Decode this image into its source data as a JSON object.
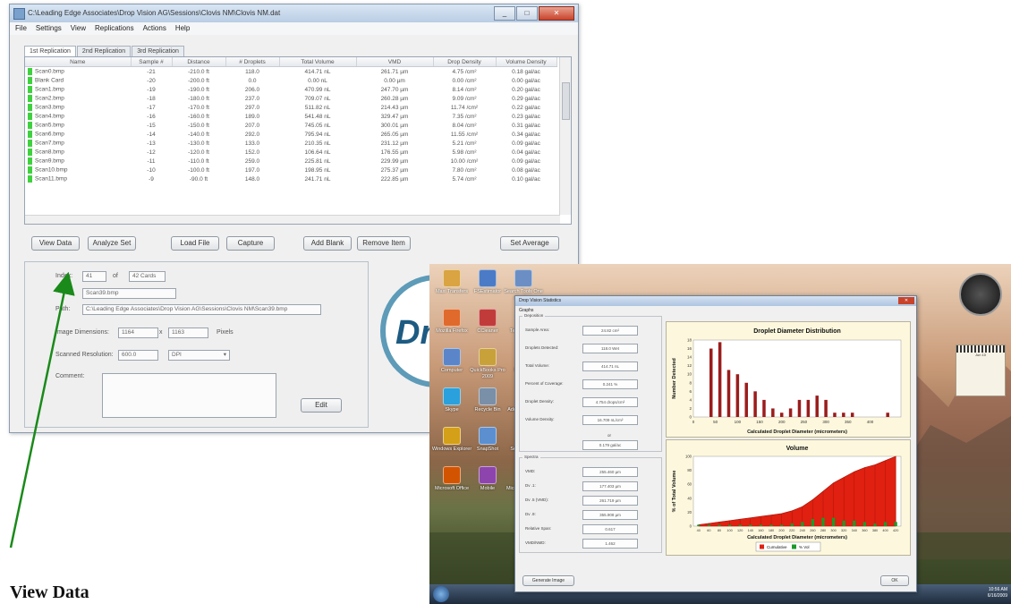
{
  "main_window": {
    "title": "C:\\Leading Edge Associates\\Drop Vision AG\\Sessions\\Clovis  NM\\Clovis  NM.dat",
    "menu": [
      "File",
      "Settings",
      "View",
      "Replications",
      "Actions",
      "Help"
    ],
    "tabs": [
      "1st Replication",
      "2nd Replication",
      "3rd Replication"
    ],
    "columns": [
      "Name",
      "Sample #",
      "Distance",
      "# Droplets",
      "Total Volume",
      "VMD",
      "Drop Density",
      "Volume Density"
    ],
    "rows": [
      [
        "Scan0.bmp",
        "-21",
        "-210.0 ft",
        "118.0",
        "414.71 nL",
        "261.71 µm",
        "4.75 /cm²",
        "0.18 gal/ac"
      ],
      [
        "Blank Card",
        "-20",
        "-200.0 ft",
        "0.0",
        "0.00 nL",
        "0.00 µm",
        "0.00 /cm²",
        "0.00 gal/ac"
      ],
      [
        "Scan1.bmp",
        "-19",
        "-190.0 ft",
        "206.0",
        "470.99 nL",
        "247.70 µm",
        "8.14 /cm²",
        "0.20 gal/ac"
      ],
      [
        "Scan2.bmp",
        "-18",
        "-180.0 ft",
        "237.0",
        "709.07 nL",
        "260.28 µm",
        "9.09 /cm²",
        "0.29 gal/ac"
      ],
      [
        "Scan3.bmp",
        "-17",
        "-170.0 ft",
        "297.0",
        "511.82 nL",
        "214.43 µm",
        "11.74 /cm²",
        "0.22 gal/ac"
      ],
      [
        "Scan4.bmp",
        "-16",
        "-160.0 ft",
        "189.0",
        "541.48 nL",
        "329.47 µm",
        "7.35 /cm²",
        "0.23 gal/ac"
      ],
      [
        "Scan5.bmp",
        "-15",
        "-150.0 ft",
        "207.0",
        "745.05 nL",
        "300.01 µm",
        "8.04 /cm²",
        "0.31 gal/ac"
      ],
      [
        "Scan6.bmp",
        "-14",
        "-140.0 ft",
        "292.0",
        "795.94 nL",
        "265.05 µm",
        "11.55 /cm²",
        "0.34 gal/ac"
      ],
      [
        "Scan7.bmp",
        "-13",
        "-130.0 ft",
        "133.0",
        "210.35 nL",
        "231.12 µm",
        "5.21 /cm²",
        "0.09 gal/ac"
      ],
      [
        "Scan8.bmp",
        "-12",
        "-120.0 ft",
        "152.0",
        "106.64 nL",
        "176.55 µm",
        "5.98 /cm²",
        "0.04 gal/ac"
      ],
      [
        "Scan9.bmp",
        "-11",
        "-110.0 ft",
        "259.0",
        "225.81 nL",
        "229.99 µm",
        "10.00 /cm²",
        "0.09 gal/ac"
      ],
      [
        "Scan10.bmp",
        "-10",
        "-100.0 ft",
        "197.0",
        "198.95 nL",
        "275.37 µm",
        "7.80 /cm²",
        "0.08 gal/ac"
      ],
      [
        "Scan11.bmp",
        "-9",
        "-90.0 ft",
        "148.0",
        "241.71 nL",
        "222.85 µm",
        "5.74 /cm²",
        "0.10 gal/ac"
      ]
    ],
    "buttons": {
      "view_data": "View Data",
      "analyze_set": "Analyze Set",
      "load_file": "Load File",
      "capture": "Capture",
      "add_blank": "Add Blank",
      "remove_item": "Remove Item",
      "set_average": "Set Average",
      "edit": "Edit"
    },
    "details": {
      "index_label": "Index:",
      "index_value": "41",
      "of_label": "of",
      "cards_value": "42 Cards",
      "name_value": "Scan39.bmp",
      "path_label": "Path:",
      "path_value": "C:\\Leading Edge Associates\\Drop Vision AG\\Sessions\\Clovis  NM\\Scan39.bmp",
      "image_dim_label": "Image Dimensions:",
      "width_value": "1164",
      "x_label": "x",
      "height_value": "1163",
      "pixels_label": "Pixels",
      "resolution_label": "Scanned Resolution:",
      "resolution_value": "600.0",
      "resolution_unit": "DPI",
      "comment_label": "Comment:"
    },
    "logo_text": "Dro"
  },
  "stats_window": {
    "title": "Drop Vision Statistics",
    "desktop_title": "C:\\Leading Edge Associates\\Drop Vision AG\\Sessions\\Clovis  NM\\Clovis  NM.dat",
    "menu": "Graphs",
    "deposition_label": "Deposition",
    "spectra_label": "Spectra",
    "deposition_fields": [
      {
        "label": "Sample Area:",
        "value": "24.82 cm²"
      },
      {
        "label": "Droplets Detected:",
        "value": "118.0 Wet"
      },
      {
        "label": "Total Volume:",
        "value": "414.71 nL"
      },
      {
        "label": "Percent of Coverage:",
        "value": "0.241 %"
      },
      {
        "label": "Droplet Density:",
        "value": "4.754 drops/cm²"
      },
      {
        "label": "Volume Density:",
        "value": "16.709 nL/cm²"
      }
    ],
    "volume_density_extra": [
      "or",
      "0.179 gal/ac"
    ],
    "spectra_fields": [
      {
        "label": "VMD:",
        "value": "255.460 µm"
      },
      {
        "label": "Dv .1:",
        "value": "177.403 µm"
      },
      {
        "label": "Dv .5 (VMD):",
        "value": "261.719 µm"
      },
      {
        "label": "Dv .9:",
        "value": "355.908 µm"
      },
      {
        "label": "Relative Span:",
        "value": "0.617"
      },
      {
        "label": "VMD/NMD:",
        "value": "1.462"
      }
    ],
    "buttons": {
      "generate_image": "Generate Image",
      "ok": "OK"
    },
    "legend": {
      "cumulative": "Cumulative",
      "vol": "% Vol"
    }
  },
  "chart_data": [
    {
      "type": "bar",
      "title": "Droplet Diameter Distribution",
      "xlabel": "Calculated Droplet Diameter (micrometers)",
      "ylabel": "Number Detected",
      "xlim": [
        0,
        470
      ],
      "ylim": [
        0,
        18
      ],
      "xticks": [
        0,
        50,
        100,
        150,
        200,
        250,
        300,
        350,
        400
      ],
      "yticks": [
        0,
        2,
        4,
        6,
        8,
        10,
        12,
        14,
        16,
        18
      ],
      "x": [
        40,
        60,
        80,
        100,
        120,
        140,
        160,
        180,
        200,
        220,
        240,
        260,
        280,
        300,
        320,
        340,
        360,
        440
      ],
      "values": [
        16,
        17.5,
        11,
        10,
        8,
        6,
        4,
        2,
        1,
        2,
        4,
        4,
        5,
        4,
        1,
        1,
        1,
        1
      ],
      "color": "#9b1c1c"
    },
    {
      "type": "area",
      "title": "Volume",
      "xlabel": "Calculated Droplet Diameter (micrometers)",
      "ylabel": "% of Total Volume",
      "ylim": [
        0,
        100
      ],
      "yticks": [
        0,
        10,
        20,
        30,
        40,
        50,
        60,
        70,
        80,
        90,
        100
      ],
      "xticks": [
        "40",
        "60",
        "80",
        "100",
        "120",
        "140",
        "160",
        "180",
        "200",
        "220",
        "240",
        "260",
        "280",
        "300",
        "320",
        "340",
        "360",
        "380",
        "400",
        "420"
      ],
      "series": [
        {
          "name": "Cumulative",
          "color": "#e02010",
          "values": [
            2,
            4,
            6,
            8,
            10,
            12,
            14,
            16,
            18,
            22,
            28,
            38,
            50,
            62,
            70,
            78,
            84,
            88,
            94,
            100
          ]
        },
        {
          "name": "% Vol",
          "color": "#1a9a2a",
          "values": [
            2,
            2,
            2,
            2,
            2,
            2,
            2,
            2,
            2,
            4,
            6,
            10,
            12,
            12,
            8,
            8,
            6,
            4,
            6,
            6
          ]
        }
      ]
    }
  ],
  "desktop": {
    "icons": [
      "Maxi Transfers",
      "FSEstimator",
      "Search Tools One at a time",
      "Mozilla Firefox",
      "CCleaner",
      "TeamViewer",
      "Computer",
      "QuickBooks Pro 2009",
      "Network",
      "Skype",
      "Recycle Bin",
      "Adobe Reader",
      "Windows Explorer",
      "SnapShot",
      "Sony Vegas",
      "Microsoft Office",
      "Mobile",
      "Microsoft Office Word"
    ],
    "clock_time": "10:56 AM",
    "clock_date": "6/16/2009",
    "calendar_month": "Jun 10"
  },
  "caption": "View Data"
}
